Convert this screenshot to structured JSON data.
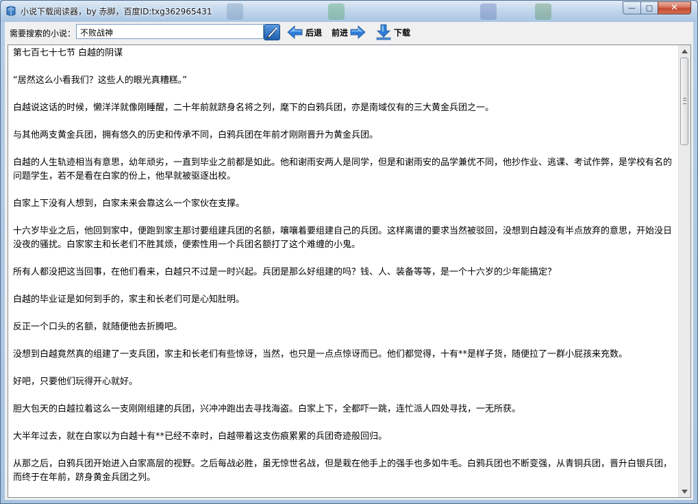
{
  "window": {
    "title": "小说下载阅读器，by 赤脚，百度ID:txg362965431",
    "controls": {
      "minimize": "—",
      "maximize": "□",
      "close": "✕"
    }
  },
  "toolbar": {
    "search_label": "需要搜索的小说：",
    "search_value": "不败战神",
    "back_label": "后退",
    "forward_label": "前进",
    "download_label": "下载"
  },
  "reader": {
    "chapter_title": "第七百七十七节 白越的阴谋",
    "paragraphs": [
      "“居然这么小看我们？这些人的眼光真糟糕。”",
      "白越说这话的时候，懒洋洋就像刚睡醒，二十年前就跻身名将之列，麾下的白鸦兵团，亦是南域仅有的三大黄金兵团之一。",
      "与其他两支黄金兵团，拥有悠久的历史和传承不同，白鸦兵团在年前才刚刚晋升为黄金兵团。",
      "白越的人生轨迹相当有意思，幼年顽劣，一直到毕业之前都是如此。他和谢雨安两人是同学，但是和谢雨安的品学兼优不同，他抄作业、逃课、考试作弊，是学校有名的问题学生，若不是看在白家的份上，他早就被驱逐出校。",
      "白家上下没有人想到，白家未来会靠这么一个家伙在支撑。",
      "十六岁毕业之后，他回到家中，便跑到家主那讨要组建兵团的名额，嚷嚷着要组建自己的兵团。这样离谱的要求当然被驳回，没想到白越没有半点放弃的意思，开始没日没夜的骚扰。白家家主和长老们不胜其烦，便索性用一个兵团名额打了这个难缠的小鬼。",
      "所有人都没把这当回事，在他们看来，白越只不过是一时兴起。兵团是那么好组建的吗？钱、人、装备等等，是一个十六岁的少年能搞定？",
      "白越的毕业证是如何到手的，家主和长老们可是心知肚明。",
      "反正一个口头的名额，就随便他去折腾吧。",
      "没想到白越竟然真的组建了一支兵团，家主和长老们有些惊讶，当然，也只是一点点惊讶而已。他们都觉得，十有**是样子货，随便拉了一群小屁孩来充数。",
      "好吧，只要他们玩得开心就好。",
      "胆大包天的白越拉着这么一支刚刚组建的兵团，兴冲冲跑出去寻找海盗。白家上下，全都吓一跳，连忙派人四处寻找，一无所获。",
      "大半年过去，就在白家以为白越十有**已经不幸时，白越带着这支伤痕累累的兵团奇迹般回归。",
      "从那之后，白鸦兵团开始进入白家高层的视野。之后每战必胜，虽无惊世名战，但是栽在他手上的强手也多如牛毛。白鸦兵团也不断变强，从青铜兵团，晋升白银兵团，而终于在年前，跻身黄金兵团之列。"
    ]
  },
  "colors": {
    "title_bar": "#bdd3ea",
    "nav_arrow": "#2f7ed8",
    "close_button": "#c24a2f"
  },
  "icons": {
    "app": "book-icon",
    "search": "search-pen-icon",
    "back": "arrow-left-icon",
    "forward": "arrow-right-icon",
    "download": "download-arrow-icon"
  }
}
